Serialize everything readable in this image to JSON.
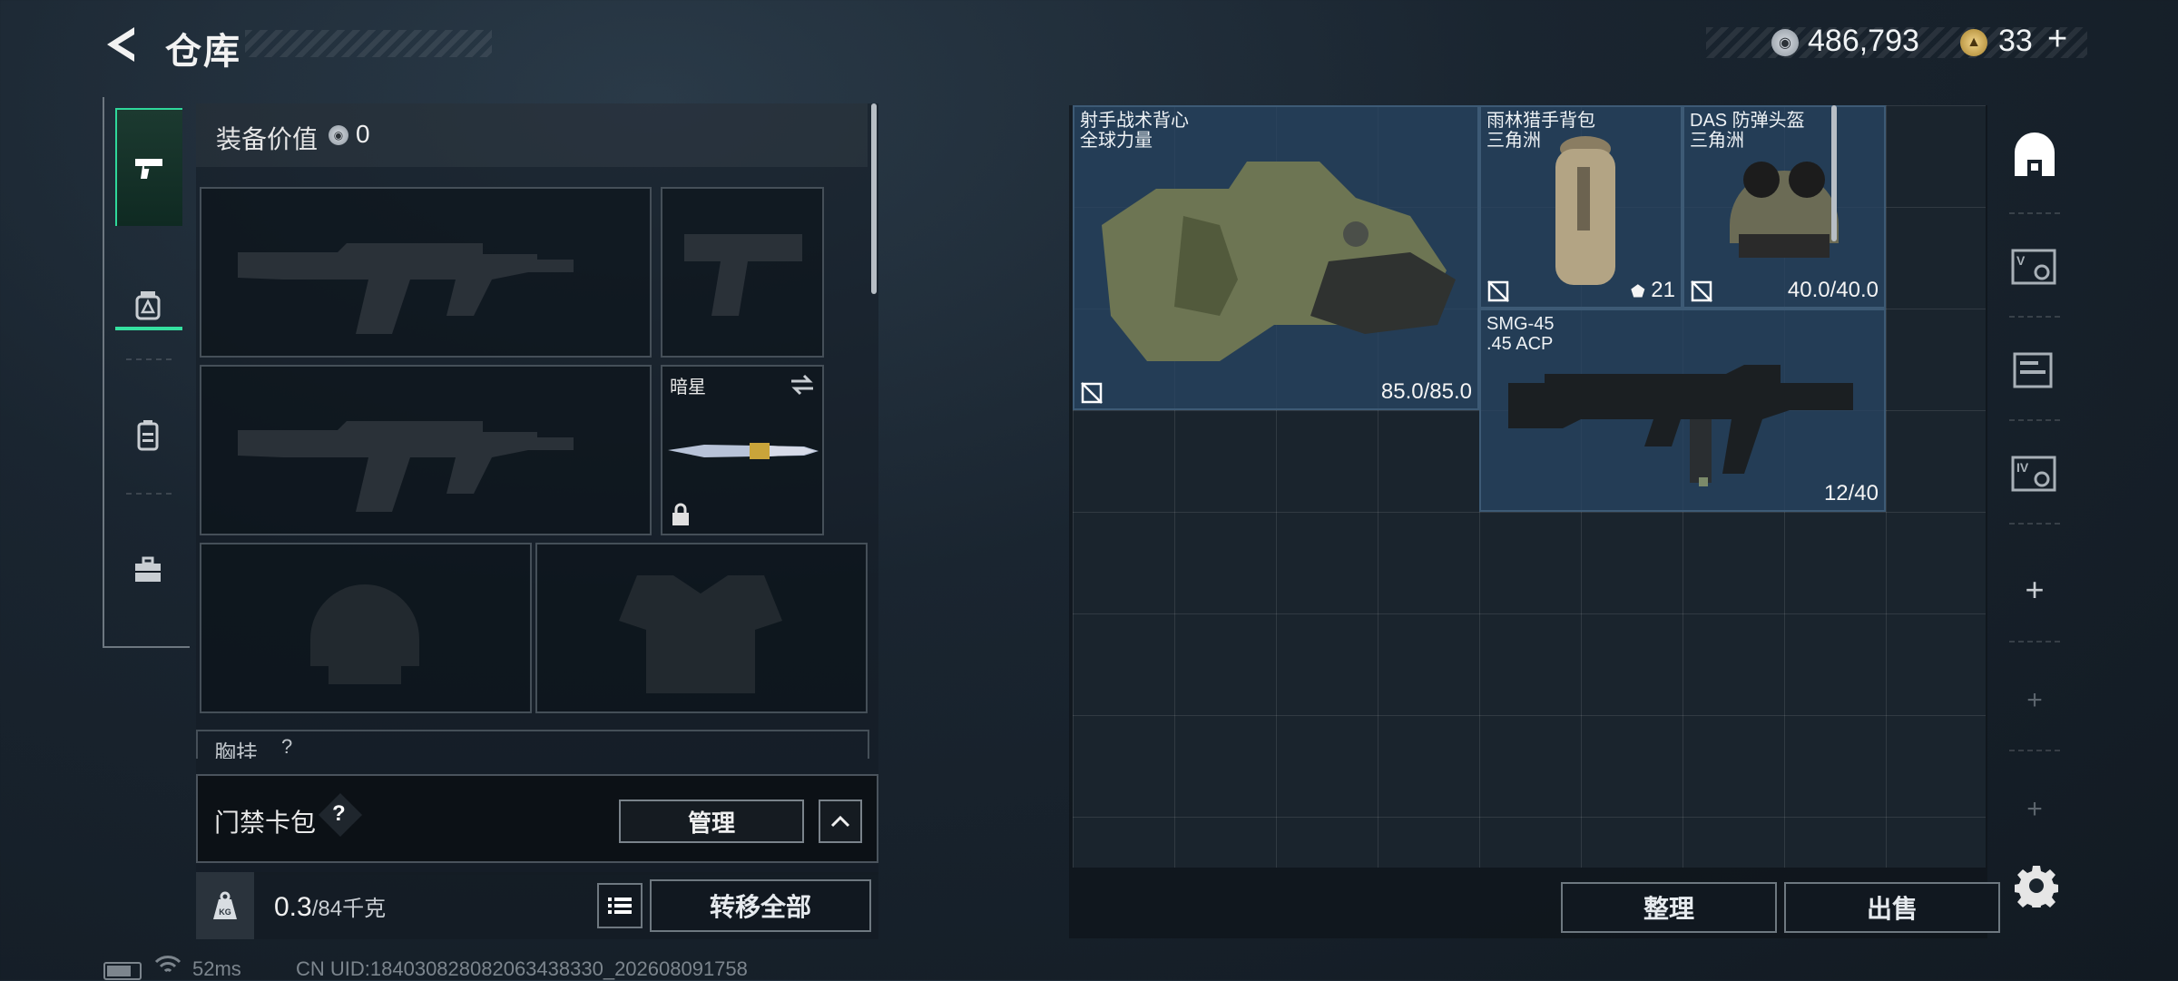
{
  "header": {
    "title": "仓库",
    "coin_value": "486,793",
    "gold_value": "33",
    "gold_plus": "+"
  },
  "equipment": {
    "label": "装备价值",
    "value": "0",
    "knife_name": "暗星",
    "chest_label": "胸挂",
    "chest_count": "?"
  },
  "keycard": {
    "label": "门禁卡包",
    "help": "?",
    "manage": "管理"
  },
  "weight": {
    "current": "0.3",
    "max": "/84千克",
    "unit_icon": "KG"
  },
  "buttons": {
    "transfer_all": "转移全部",
    "sort": "整理",
    "sell": "出售"
  },
  "status": {
    "ping": "52ms",
    "uid": "CN UID:184030828082063438330_202608091758",
    "battery_level": 0.75
  },
  "stash_items": [
    {
      "name": "射手战术背心",
      "sub": "全球力量",
      "durability": "85.0/85.0"
    },
    {
      "name": "雨林猎手背包",
      "sub": "三角洲",
      "capacity": "21"
    },
    {
      "name": "DAS 防弹头盔",
      "sub": "三角洲",
      "durability": "40.0/40.0"
    },
    {
      "name": "SMG-45",
      "sub": ".45 ACP",
      "ammo": "12/40"
    }
  ],
  "right_nav": {
    "tab_v": "V",
    "tab_iv": "IV",
    "add1": "+",
    "add2": "+",
    "add3": "+"
  },
  "icons": [
    "back-arrow-icon",
    "silver-coin-icon",
    "gold-coin-icon",
    "pistol-icon",
    "grenade-icon",
    "backpack-icon",
    "toolbox-icon",
    "swap-icon",
    "lock-icon",
    "chevron-up-icon",
    "kg-weight-icon",
    "list-icon",
    "battery-icon",
    "wifi-icon",
    "shelter-icon",
    "gear-icon",
    "no-insure-icon"
  ]
}
